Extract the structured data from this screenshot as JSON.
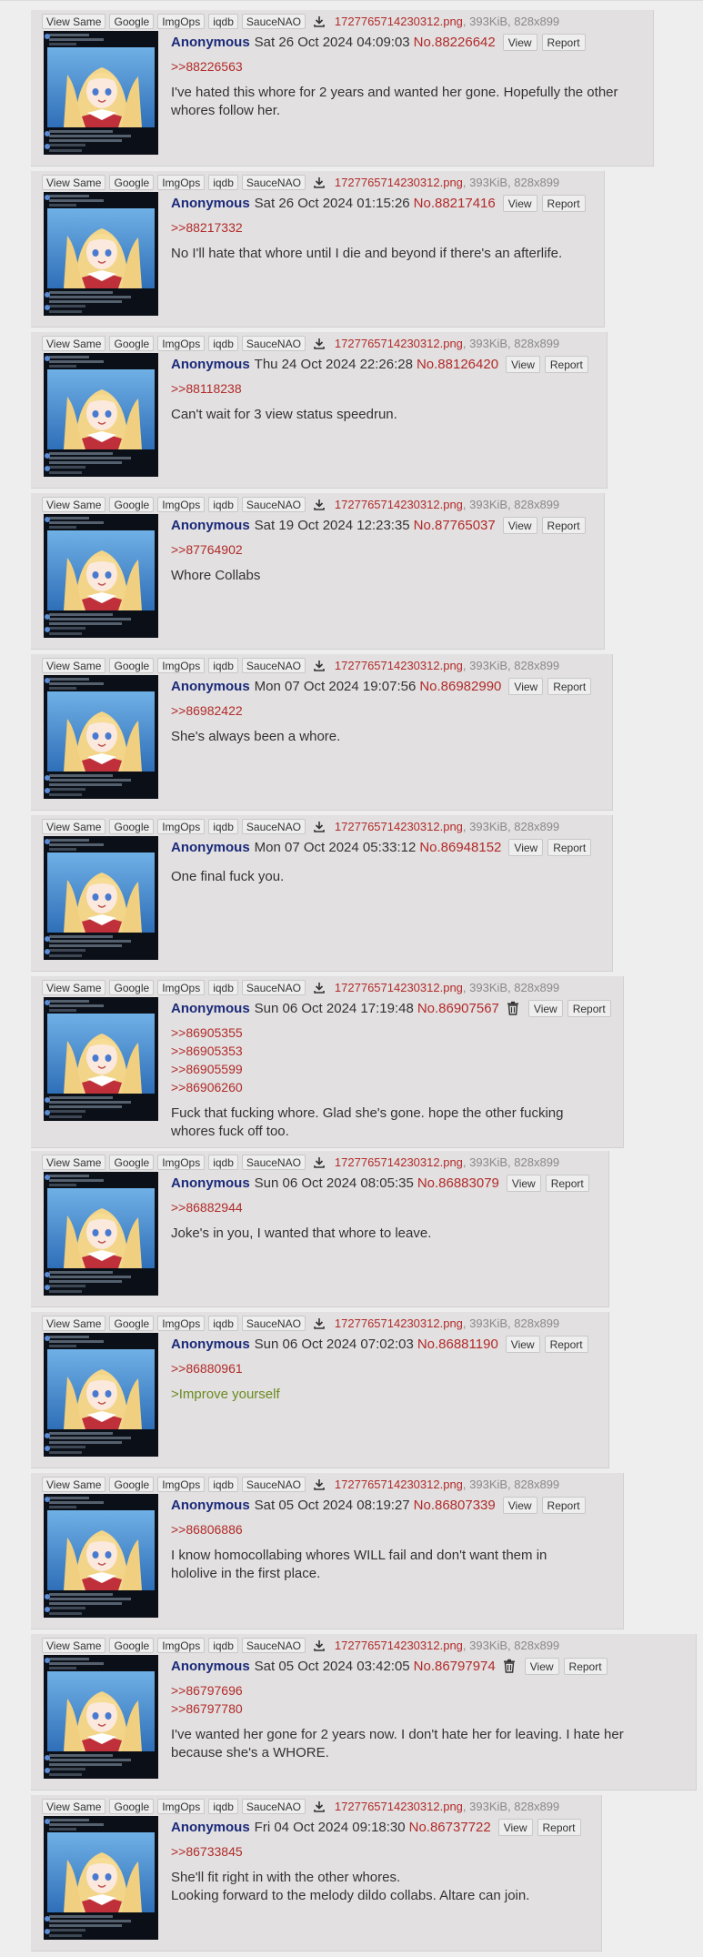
{
  "toolbar_labels": {
    "view_same": "View Same",
    "google": "Google",
    "imgops": "ImgOps",
    "iqdb": "iqdb",
    "saucenao": "SauceNAO",
    "download_icon": "download-icon"
  },
  "file": {
    "name": "1727765714230312.png",
    "meta": ", 393KiB, 828x899"
  },
  "header_labels": {
    "view": "View",
    "report": "Report",
    "delete_icon": "trash-icon"
  },
  "colors": {
    "name": "#1b2a7a",
    "post_number": "#b22a2a",
    "quote_link": "#b22a2a",
    "greentext": "#6a8a20",
    "post_background": "#e2e0e0",
    "page_background": "#eeeeee"
  },
  "posts": [
    {
      "name": "Anonymous",
      "date": "Sat 26 Oct 2024 04:09:03",
      "number": "No.88226642",
      "has_delete": false,
      "quotes": [
        "&gt;&gt;88226563"
      ],
      "lines": [
        "I've hated this whore for 2 years and wanted her gone. Hopefully the other",
        "whores follow her."
      ],
      "greentext": []
    },
    {
      "name": "Anonymous",
      "date": "Sat 26 Oct 2024 01:15:26",
      "number": "No.88217416",
      "has_delete": false,
      "quotes": [
        "&gt;&gt;88217332"
      ],
      "lines": [
        "No I'll hate that whore until I die and beyond if there's an afterlife."
      ],
      "greentext": []
    },
    {
      "name": "Anonymous",
      "date": "Thu 24 Oct 2024 22:26:28",
      "number": "No.88126420",
      "has_delete": false,
      "quotes": [
        "&gt;&gt;88118238"
      ],
      "lines": [
        "Can't wait for 3 view status speedrun."
      ],
      "greentext": []
    },
    {
      "name": "Anonymous",
      "date": "Sat 19 Oct 2024 12:23:35",
      "number": "No.87765037",
      "has_delete": false,
      "quotes": [
        "&gt;&gt;87764902"
      ],
      "lines": [
        "Whore Collabs"
      ],
      "greentext": []
    },
    {
      "name": "Anonymous",
      "date": "Mon 07 Oct 2024 19:07:56",
      "number": "No.86982990",
      "has_delete": false,
      "quotes": [
        "&gt;&gt;86982422"
      ],
      "lines": [
        "She's always been a whore."
      ],
      "greentext": []
    },
    {
      "name": "Anonymous",
      "date": "Mon 07 Oct 2024 05:33:12",
      "number": "No.86948152",
      "has_delete": false,
      "quotes": [],
      "lines": [
        "One final fuck you."
      ],
      "greentext": []
    },
    {
      "name": "Anonymous",
      "date": "Sun 06 Oct 2024 17:19:48",
      "number": "No.86907567",
      "has_delete": true,
      "quotes": [
        "&gt;&gt;86905355",
        "&gt;&gt;86905353",
        "&gt;&gt;86905599",
        "&gt;&gt;86906260"
      ],
      "lines": [
        "Fuck that fucking whore. Glad she's gone. hope the other fucking",
        "whores fuck off too."
      ],
      "greentext": []
    },
    {
      "name": "Anonymous",
      "date": "Sun 06 Oct 2024 08:05:35",
      "number": "No.86883079",
      "has_delete": false,
      "quotes": [
        "&gt;&gt;86882944"
      ],
      "lines": [
        "Joke's in you, I wanted that whore to leave."
      ],
      "greentext": []
    },
    {
      "name": "Anonymous",
      "date": "Sun 06 Oct 2024 07:02:03",
      "number": "No.86881190",
      "has_delete": false,
      "quotes": [
        "&gt;&gt;86880961"
      ],
      "lines": [],
      "greentext": [
        "&gt;Improve yourself"
      ]
    },
    {
      "name": "Anonymous",
      "date": "Sat 05 Oct 2024 08:19:27",
      "number": "No.86807339",
      "has_delete": false,
      "quotes": [
        "&gt;&gt;86806886"
      ],
      "lines": [
        "I know homocollabing whores WILL fail and don't want them in",
        "hololive in the first place."
      ],
      "greentext": []
    },
    {
      "name": "Anonymous",
      "date": "Sat 05 Oct 2024 03:42:05",
      "number": "No.86797974",
      "has_delete": true,
      "quotes": [
        "&gt;&gt;86797696",
        "&gt;&gt;86797780"
      ],
      "lines": [
        "I've wanted her gone for 2 years now. I don't hate her for leaving. I hate her",
        "because she's a WHORE."
      ],
      "greentext": []
    },
    {
      "name": "Anonymous",
      "date": "Fri 04 Oct 2024 09:18:30",
      "number": "No.86737722",
      "has_delete": false,
      "quotes": [
        "&gt;&gt;86733845"
      ],
      "lines": [
        "She'll fit right in with the other whores.",
        "Looking forward to the melody dildo collabs. Altare can join."
      ],
      "greentext": []
    }
  ]
}
